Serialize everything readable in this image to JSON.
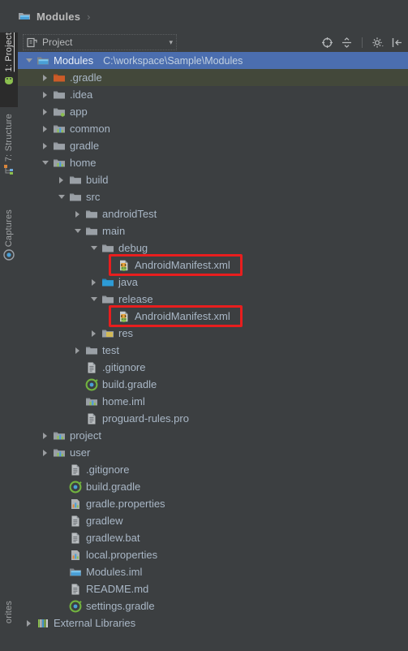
{
  "window": {
    "breadcrumb_title": "Modules",
    "breadcrumb_separator": "›",
    "breadcrumb_icon": "module-icon"
  },
  "colors": {
    "background": "#3c3f41",
    "selection": "#4b6eaf",
    "text": "#a9b7c6",
    "highlight_box": "#e81e1e",
    "folder": "#9aa0a6",
    "folder_gradle": "#cc5c28",
    "source_root": "#2d9bd6",
    "gradle_green": "#5a9e43"
  },
  "side_tabs": [
    {
      "label": "1: Project",
      "icon": "project-icon",
      "active": true
    },
    {
      "label": "7: Structure",
      "icon": "structure-icon",
      "active": false
    },
    {
      "label": "Captures",
      "icon": "captures-icon",
      "active": false
    },
    {
      "label": "orites",
      "icon": "favorites-icon",
      "active": false
    }
  ],
  "panel_header": {
    "view_selector": "Project",
    "view_selector_icon": "project-view-icon",
    "dropdown_arrow": "▾",
    "toolbar_icons": [
      {
        "name": "locate-target-icon",
        "title": "Select Opened File"
      },
      {
        "name": "collapse-all-icon",
        "title": "Collapse All"
      },
      {
        "name": "settings-gear-icon",
        "title": "Settings"
      },
      {
        "name": "hide-panel-icon",
        "title": "Hide"
      }
    ]
  },
  "tree": [
    {
      "label": "Modules",
      "sublabel": "C:\\workspace\\Sample\\Modules",
      "depth": 0,
      "toggle": "down",
      "icon": "module-root-icon",
      "state": "selected"
    },
    {
      "label": ".gradle",
      "sublabel": "",
      "depth": 1,
      "toggle": "right",
      "icon": "folder-orange-icon",
      "state": "hover"
    },
    {
      "label": ".idea",
      "sublabel": "",
      "depth": 1,
      "toggle": "right",
      "icon": "folder-icon",
      "state": ""
    },
    {
      "label": "app",
      "sublabel": "",
      "depth": 1,
      "toggle": "right",
      "icon": "module-green-dot-icon",
      "state": ""
    },
    {
      "label": "common",
      "sublabel": "",
      "depth": 1,
      "toggle": "right",
      "icon": "module-icon",
      "state": ""
    },
    {
      "label": "gradle",
      "sublabel": "",
      "depth": 1,
      "toggle": "right",
      "icon": "folder-icon",
      "state": ""
    },
    {
      "label": "home",
      "sublabel": "",
      "depth": 1,
      "toggle": "down",
      "icon": "module-icon",
      "state": ""
    },
    {
      "label": "build",
      "sublabel": "",
      "depth": 2,
      "toggle": "right",
      "icon": "folder-icon",
      "state": ""
    },
    {
      "label": "src",
      "sublabel": "",
      "depth": 2,
      "toggle": "down",
      "icon": "folder-icon",
      "state": ""
    },
    {
      "label": "androidTest",
      "sublabel": "",
      "depth": 3,
      "toggle": "right",
      "icon": "folder-icon",
      "state": ""
    },
    {
      "label": "main",
      "sublabel": "",
      "depth": 3,
      "toggle": "down",
      "icon": "folder-icon",
      "state": ""
    },
    {
      "label": "debug",
      "sublabel": "",
      "depth": 4,
      "toggle": "down",
      "icon": "folder-icon",
      "state": ""
    },
    {
      "label": "AndroidManifest.xml",
      "sublabel": "",
      "depth": 5,
      "toggle": "none",
      "icon": "android-manifest-icon",
      "state": "highlighted"
    },
    {
      "label": "java",
      "sublabel": "",
      "depth": 4,
      "toggle": "right",
      "icon": "folder-source-icon",
      "state": ""
    },
    {
      "label": "release",
      "sublabel": "",
      "depth": 4,
      "toggle": "down",
      "icon": "folder-icon",
      "state": ""
    },
    {
      "label": "AndroidManifest.xml",
      "sublabel": "",
      "depth": 5,
      "toggle": "none",
      "icon": "android-manifest-icon",
      "state": "highlighted"
    },
    {
      "label": "res",
      "sublabel": "",
      "depth": 4,
      "toggle": "right",
      "icon": "folder-res-icon",
      "state": ""
    },
    {
      "label": "test",
      "sublabel": "",
      "depth": 3,
      "toggle": "right",
      "icon": "folder-icon",
      "state": ""
    },
    {
      "label": ".gitignore",
      "sublabel": "",
      "depth": 3,
      "toggle": "none",
      "icon": "text-file-icon",
      "state": ""
    },
    {
      "label": "build.gradle",
      "sublabel": "",
      "depth": 3,
      "toggle": "none",
      "icon": "gradle-file-icon",
      "state": ""
    },
    {
      "label": "home.iml",
      "sublabel": "",
      "depth": 3,
      "toggle": "none",
      "icon": "iml-module-icon",
      "state": ""
    },
    {
      "label": "proguard-rules.pro",
      "sublabel": "",
      "depth": 3,
      "toggle": "none",
      "icon": "text-file-icon",
      "state": ""
    },
    {
      "label": "project",
      "sublabel": "",
      "depth": 1,
      "toggle": "right",
      "icon": "module-icon",
      "state": ""
    },
    {
      "label": "user",
      "sublabel": "",
      "depth": 1,
      "toggle": "right",
      "icon": "module-icon",
      "state": ""
    },
    {
      "label": ".gitignore",
      "sublabel": "",
      "depth": 2,
      "toggle": "none",
      "icon": "text-file-icon",
      "state": ""
    },
    {
      "label": "build.gradle",
      "sublabel": "",
      "depth": 2,
      "toggle": "none",
      "icon": "gradle-file-icon",
      "state": ""
    },
    {
      "label": "gradle.properties",
      "sublabel": "",
      "depth": 2,
      "toggle": "none",
      "icon": "properties-file-icon",
      "state": ""
    },
    {
      "label": "gradlew",
      "sublabel": "",
      "depth": 2,
      "toggle": "none",
      "icon": "text-file-icon",
      "state": ""
    },
    {
      "label": "gradlew.bat",
      "sublabel": "",
      "depth": 2,
      "toggle": "none",
      "icon": "text-file-icon",
      "state": ""
    },
    {
      "label": "local.properties",
      "sublabel": "",
      "depth": 2,
      "toggle": "none",
      "icon": "properties-file-icon",
      "state": ""
    },
    {
      "label": "Modules.iml",
      "sublabel": "",
      "depth": 2,
      "toggle": "none",
      "icon": "module-root-icon",
      "state": ""
    },
    {
      "label": "README.md",
      "sublabel": "",
      "depth": 2,
      "toggle": "none",
      "icon": "text-file-icon",
      "state": ""
    },
    {
      "label": "settings.gradle",
      "sublabel": "",
      "depth": 2,
      "toggle": "none",
      "icon": "gradle-file-icon",
      "state": ""
    },
    {
      "label": "External Libraries",
      "sublabel": "",
      "depth": 0,
      "toggle": "right",
      "icon": "external-libraries-icon",
      "state": ""
    }
  ]
}
